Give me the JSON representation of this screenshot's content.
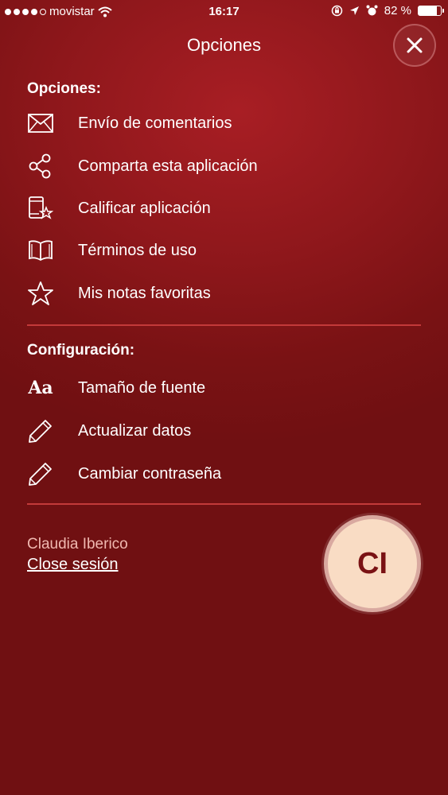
{
  "status_bar": {
    "carrier": "movistar",
    "time": "16:17",
    "battery_percent_text": "82 %",
    "battery_level": 0.82,
    "icons": [
      "signal-dots-icon",
      "wifi-icon",
      "screen-lock-icon",
      "location-icon",
      "alarm-icon",
      "battery-icon"
    ]
  },
  "header": {
    "title": "Opciones",
    "close_icon": "close-icon"
  },
  "opciones_section": {
    "title": "Opciones:",
    "items": [
      {
        "label": "Envío de comentarios",
        "icon": "envelope-icon"
      },
      {
        "label": "Comparta esta aplicación",
        "icon": "share-icon"
      },
      {
        "label": "Calificar aplicación",
        "icon": "rate-app-icon"
      },
      {
        "label": "Términos de uso",
        "icon": "book-icon"
      },
      {
        "label": "Mis notas favoritas",
        "icon": "star-icon"
      }
    ]
  },
  "config_section": {
    "title": "Configuración:",
    "items": [
      {
        "label": "Tamaño de fuente",
        "icon": "font-size-icon",
        "glyph": "Aa"
      },
      {
        "label": "Actualizar datos",
        "icon": "pencil-icon"
      },
      {
        "label": "Cambiar contraseña",
        "icon": "pencil-icon"
      }
    ]
  },
  "user": {
    "name": "Claudia Iberico",
    "logout_label": "Close sesión",
    "initials": "CI"
  },
  "colors": {
    "background": "#8e171b",
    "divider": "#c33a3a",
    "avatar_bg": "#f9dcc4",
    "user_name": "#f0b8b0"
  }
}
